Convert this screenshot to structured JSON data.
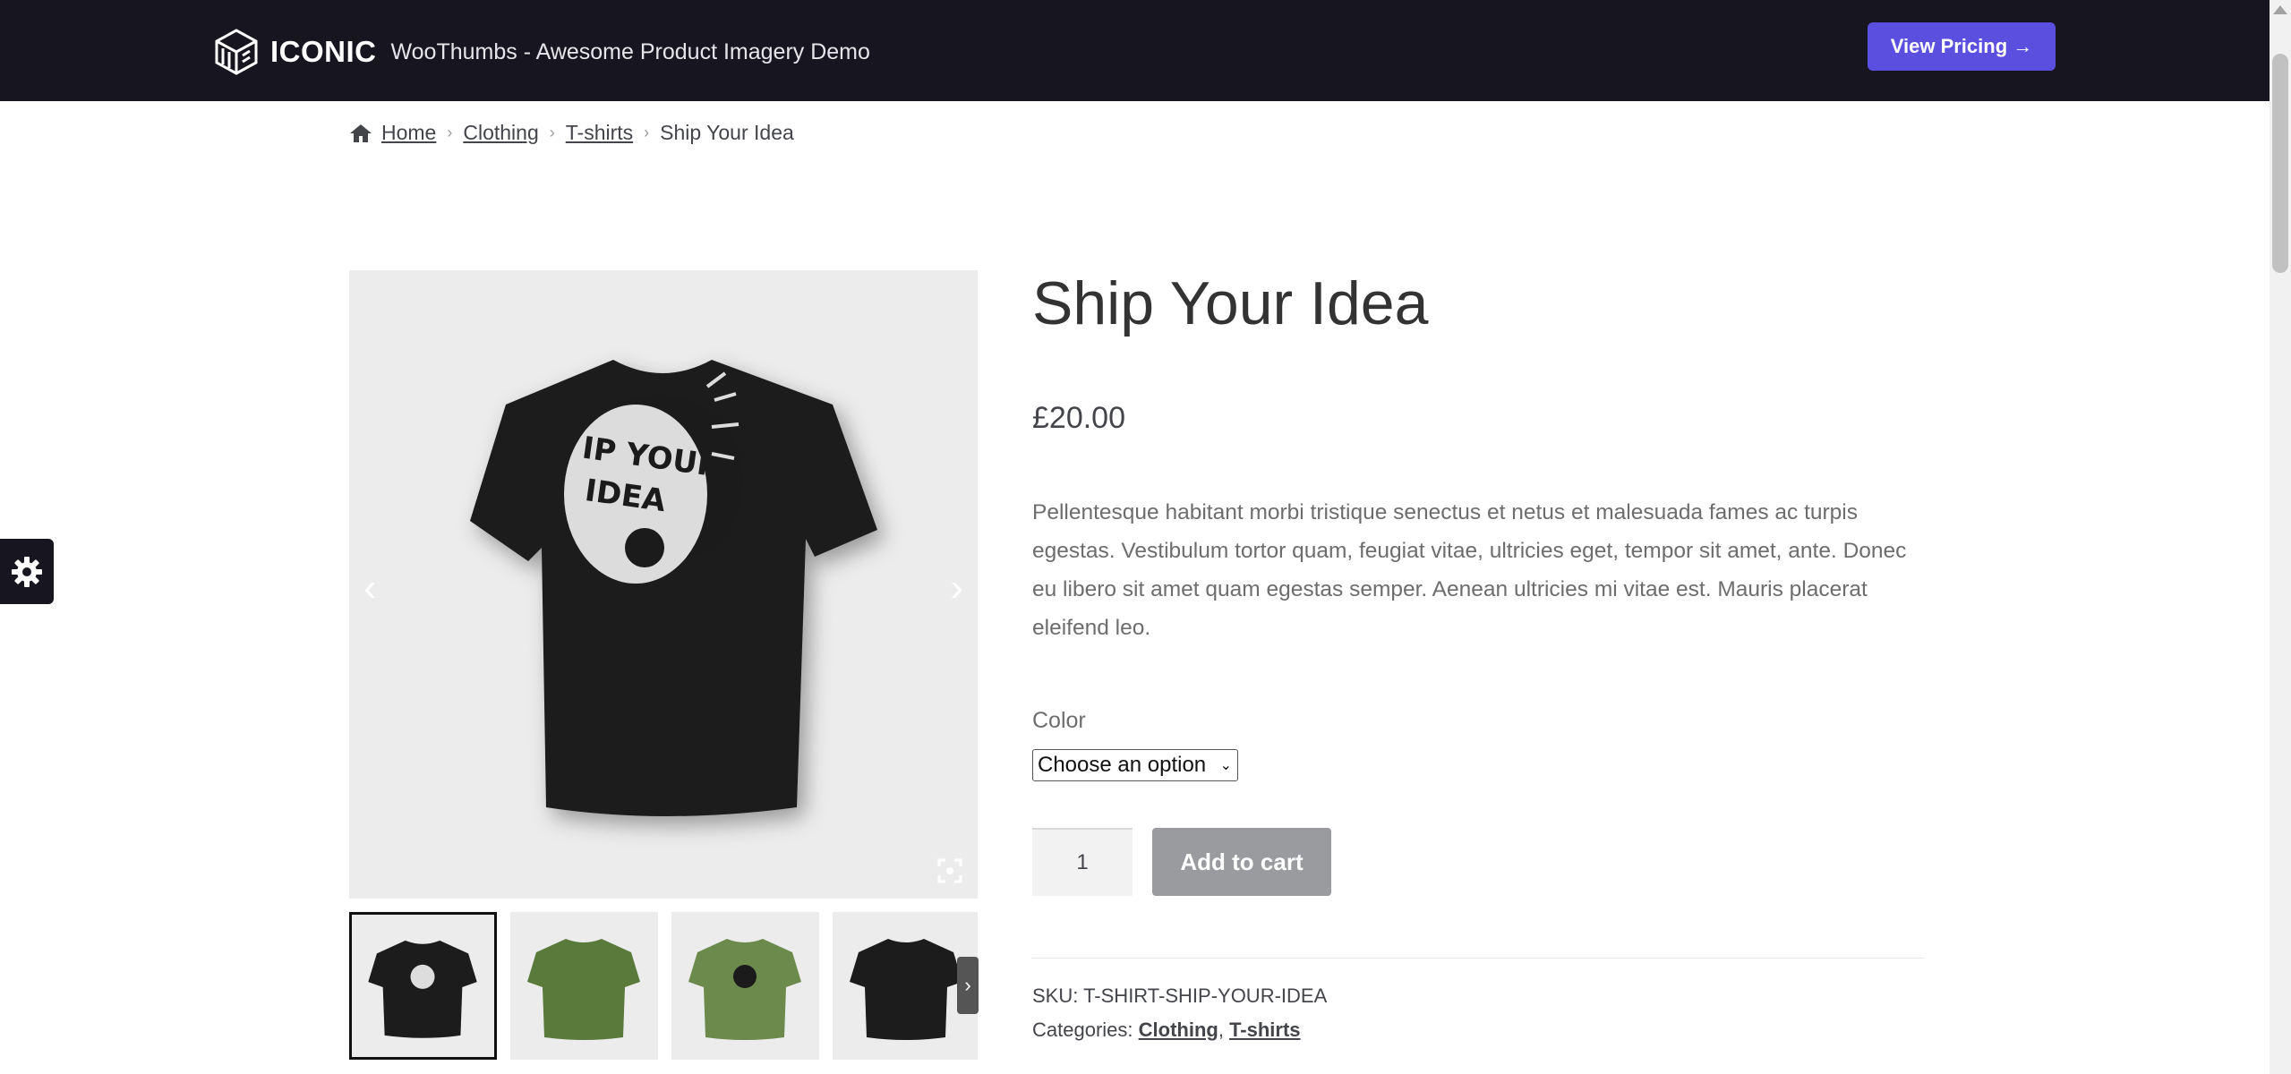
{
  "header": {
    "brand": "ICONIC",
    "tagline": "WooThumbs - Awesome Product Imagery Demo",
    "cta_label": "View Pricing →"
  },
  "breadcrumb": {
    "home": "Home",
    "items": [
      "Clothing",
      "T-shirts"
    ],
    "current": "Ship Your Idea"
  },
  "product": {
    "title": "Ship Your Idea",
    "price": "£20.00",
    "description": "Pellentesque habitant morbi tristique senectus et netus et malesuada fames ac turpis egestas. Vestibulum tortor quam, feugiat vitae, ultricies eget, tempor sit amet, ante. Donec eu libero sit amet quam egestas semper. Aenean ultricies mi vitae est. Mauris placerat eleifend leo.",
    "color_label": "Color",
    "color_select": "Choose an option",
    "quantity": "1",
    "add_to_cart": "Add to cart",
    "sku_label": "SKU:",
    "sku": "T-SHIRT-SHIP-YOUR-IDEA",
    "categories_label": "Categories:",
    "categories": [
      "Clothing",
      "T-shirts"
    ]
  },
  "gallery": {
    "main_print_text": "IP YOUR IDEA",
    "thumb_colors": [
      "#1c1c1c",
      "#5a7a3c",
      "#6b8a4c",
      "#1c1c1c"
    ]
  },
  "colors": {
    "topbar": "#17151f",
    "accent": "#5b4fe0",
    "button_disabled": "#9a9b9e"
  }
}
